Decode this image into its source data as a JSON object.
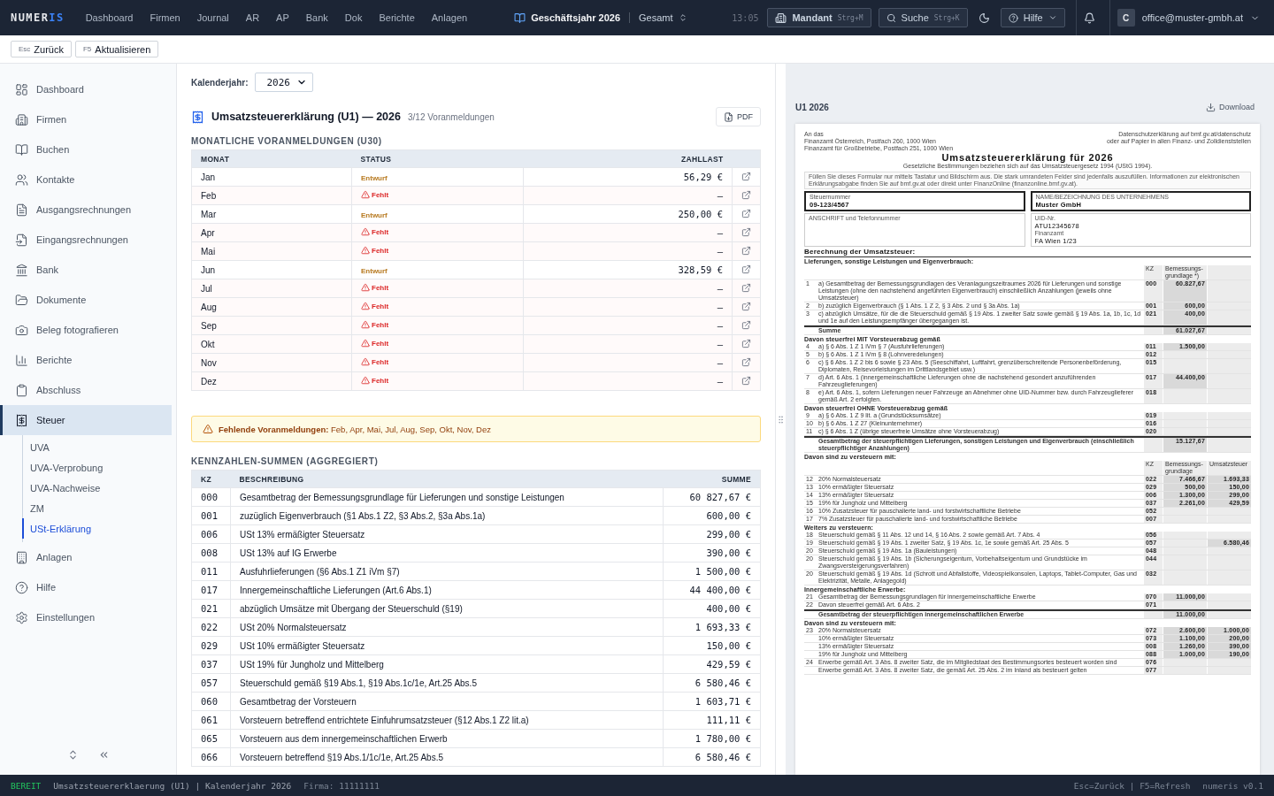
{
  "topbar": {
    "logo_main": "NUMER",
    "logo_accent": "IS",
    "nav": [
      "Dashboard",
      "Firmen",
      "Journal",
      "AR",
      "AP",
      "Bank",
      "Dok",
      "Berichte",
      "Anlagen"
    ],
    "fiscal_year": "Geschäftsjahr 2026",
    "scope": "Gesamt",
    "time": "13:05",
    "mandant": {
      "label": "Mandant",
      "shortcut": "Strg+M"
    },
    "search": {
      "label": "Suche",
      "shortcut": "Strg+K"
    },
    "help": "Hilfe",
    "avatar": "C",
    "email": "office@muster-gmbh.at"
  },
  "toolbar": [
    {
      "key": "Esc",
      "label": "Zurück"
    },
    {
      "key": "F5",
      "label": "Aktualisieren"
    }
  ],
  "sidebar": {
    "items": [
      {
        "label": "Dashboard",
        "selected": false
      },
      {
        "label": "Firmen",
        "selected": false
      },
      {
        "label": "Buchen",
        "selected": false
      },
      {
        "label": "Kontakte",
        "selected": false
      },
      {
        "label": "Ausgangsrechnungen",
        "selected": false
      },
      {
        "label": "Eingangsrechnungen",
        "selected": false
      },
      {
        "label": "Bank",
        "selected": false
      },
      {
        "label": "Dokumente",
        "selected": false
      },
      {
        "label": "Beleg fotografieren",
        "selected": false
      },
      {
        "label": "Berichte",
        "selected": false
      },
      {
        "label": "Abschluss",
        "selected": false
      },
      {
        "label": "Steuer",
        "selected": true,
        "children": [
          {
            "label": "UVA",
            "selected": false
          },
          {
            "label": "UVA-Verprobung",
            "selected": false
          },
          {
            "label": "UVA-Nachweise",
            "selected": false
          },
          {
            "label": "ZM",
            "selected": false
          },
          {
            "label": "USt-Erklärung",
            "selected": true
          }
        ]
      },
      {
        "label": "Anlagen",
        "selected": false
      },
      {
        "label": "Hilfe",
        "selected": false
      },
      {
        "label": "Einstellungen",
        "selected": false
      }
    ]
  },
  "filter": {
    "label": "Kalenderjahr:",
    "value": "2026"
  },
  "card": {
    "title": "Umsatzsteuererklärung (U1) — 2026",
    "subtitle": "3/12 Voranmeldungen",
    "pdf_button": "PDF"
  },
  "monthly": {
    "heading": "MONATLICHE VORANMELDUNGEN (U30)",
    "columns": [
      "MONAT",
      "STATUS",
      "ZAHLLAST"
    ],
    "rows": [
      {
        "month": "Jan",
        "status": {
          "kind": "draft",
          "label": "Entwurf"
        },
        "amount": "56,29 €"
      },
      {
        "month": "Feb",
        "status": {
          "kind": "missing",
          "label": "Fehlt"
        },
        "amount": "–"
      },
      {
        "month": "Mar",
        "status": {
          "kind": "draft",
          "label": "Entwurf"
        },
        "amount": "250,00 €"
      },
      {
        "month": "Apr",
        "status": {
          "kind": "missing",
          "label": "Fehlt"
        },
        "amount": "–"
      },
      {
        "month": "Mai",
        "status": {
          "kind": "missing",
          "label": "Fehlt"
        },
        "amount": "–"
      },
      {
        "month": "Jun",
        "status": {
          "kind": "draft",
          "label": "Entwurf"
        },
        "amount": "328,59 €"
      },
      {
        "month": "Jul",
        "status": {
          "kind": "missing",
          "label": "Fehlt"
        },
        "amount": "–"
      },
      {
        "month": "Aug",
        "status": {
          "kind": "missing",
          "label": "Fehlt"
        },
        "amount": "–"
      },
      {
        "month": "Sep",
        "status": {
          "kind": "missing",
          "label": "Fehlt"
        },
        "amount": "–"
      },
      {
        "month": "Okt",
        "status": {
          "kind": "missing",
          "label": "Fehlt"
        },
        "amount": "–"
      },
      {
        "month": "Nov",
        "status": {
          "kind": "missing",
          "label": "Fehlt"
        },
        "amount": "–"
      },
      {
        "month": "Dez",
        "status": {
          "kind": "missing",
          "label": "Fehlt"
        },
        "amount": "–"
      }
    ]
  },
  "warning": "**Fehlende Voranmeldungen:** Feb, Apr, Mai, Jul, Aug, Sep, Okt, Nov, Dez",
  "totals": {
    "heading": "KENNZAHLEN-SUMMEN (AGGREGIERT)",
    "columns": [
      "KZ",
      "BESCHREIBUNG",
      "SUMME"
    ],
    "rows": [
      {
        "kz": "000",
        "text": "Gesamtbetrag der Bemessungsgrundlage für Lieferungen und sonstige Leistungen",
        "sum": "60 827,67 €"
      },
      {
        "kz": "001",
        "text": "zuzüglich Eigenverbrauch (§1 Abs.1 Z2, §3 Abs.2, §3a Abs.1a)",
        "sum": "600,00 €"
      },
      {
        "kz": "006",
        "text": "USt 13% ermäßigter Steuersatz",
        "sum": "299,00 €"
      },
      {
        "kz": "008",
        "text": "USt 13% auf IG Erwerbe",
        "sum": "390,00 €"
      },
      {
        "kz": "011",
        "text": "Ausfuhrlieferungen (§6 Abs.1 Z1 iVm §7)",
        "sum": "1 500,00 €"
      },
      {
        "kz": "017",
        "text": "Innergemeinschaftliche Lieferungen (Art.6 Abs.1)",
        "sum": "44 400,00 €"
      },
      {
        "kz": "021",
        "text": "abzüglich Umsätze mit Übergang der Steuerschuld (§19)",
        "sum": "400,00 €"
      },
      {
        "kz": "022",
        "text": "USt 20% Normalsteuersatz",
        "sum": "1 693,33 €"
      },
      {
        "kz": "029",
        "text": "USt 10% ermäßigter Steuersatz",
        "sum": "150,00 €"
      },
      {
        "kz": "037",
        "text": "USt 19% für Jungholz und Mittelberg",
        "sum": "429,59 €"
      },
      {
        "kz": "057",
        "text": "Steuerschuld gemäß §19 Abs.1, §19 Abs.1c/1e, Art.25 Abs.5",
        "sum": "6 580,46 €"
      },
      {
        "kz": "060",
        "text": "Gesamtbetrag der Vorsteuern",
        "sum": "1 603,71 €"
      },
      {
        "kz": "061",
        "text": "Vorsteuern betreffend entrichtete Einfuhrumsatzsteuer (§12 Abs.1 Z2 lit.a)",
        "sum": "111,11 €"
      },
      {
        "kz": "065",
        "text": "Vorsteuern aus dem innergemeinschaftlichen Erwerb",
        "sum": "1 780,00 €"
      },
      {
        "kz": "066",
        "text": "Vorsteuern betreffend §19 Abs.1/1c/1e, Art.25 Abs.5",
        "sum": "6 580,46 €"
      }
    ]
  },
  "preview": {
    "title": "U1 2026",
    "download": "Download",
    "document": {
      "address": [
        "An das",
        "Finanzamt Österreich, Postfach 260, 1000 Wien",
        "Finanzamt für Großbetriebe, Postfach 251, 1000 Wien"
      ],
      "privacy": [
        "Datenschutzerklärung auf bmf.gv.at/datenschutz",
        "oder auf Papier in allen Finanz- und Zolldienststellen"
      ],
      "title": "Umsatzsteuererklärung für 2026",
      "subtitle": "Gesetzliche Bestimmungen beziehen sich auf das Umsatzsteuergesetz 1994 (UStG 1994).",
      "notice": "Füllen Sie dieses Formular nur mittels Tastatur und Bildschirm aus. Die stark umrandeten Felder sind jedenfalls auszufüllen. Informationen zur elektronischen Erklärungsabgabe finden Sie auf bmf.gv.at oder direkt unter FinanzOnline (finanzonline.bmf.gv.at).",
      "tax_number": {
        "label": "Steuernummer",
        "value": "09-123/4567"
      },
      "company": {
        "label": "NAME/BEZEICHNUNG DES UNTERNEHMENS",
        "value": "Muster GmbH"
      },
      "address_field": {
        "label": "ANSCHRIFT und Telefonnummer"
      },
      "uid": {
        "label": "UID-Nr.",
        "value": "ATU12345678"
      },
      "office": {
        "label": "Finanzamt",
        "value": "FA Wien 1/23"
      },
      "section": "Berechnung der Umsatzsteuer:",
      "blocks": [
        {
          "heading": "Lieferungen, sonstige Leistungen und Eigenverbrauch:",
          "columns": [
            "KZ",
            "Bemessungs- grundlage *)"
          ],
          "rows": [
            {
              "kind": "line",
              "nr": "1",
              "text": "a) Gesamtbetrag der Bemessungsgrundlagen des Veranlagungszeitraumes 2026 für Lieferungen und sonstige Leistungen (ohne den nachstehend angeführten Eigenverbrauch) einschließlich Anzahlungen (jeweils ohne Umsatzsteuer)",
              "kz": "000",
              "base": "60.827,67"
            },
            {
              "kind": "line",
              "nr": "2",
              "text": "b) zuzüglich Eigenverbrauch (§ 1 Abs. 1 Z 2, § 3 Abs. 2 und § 3a Abs. 1a)",
              "kz": "001",
              "base": "600,00"
            },
            {
              "kind": "line",
              "nr": "3",
              "text": "c) abzüglich Umsätze, für die die Steuerschuld gemäß § 19 Abs. 1 zweiter Satz sowie gemäß § 19 Abs. 1a, 1b, 1c, 1d und 1e auf den Leistungsempfänger übergegangen ist.",
              "kz": "021",
              "base": "400,00"
            },
            {
              "kind": "sum",
              "text": "Summe",
              "base": "61.027,67"
            }
          ]
        },
        {
          "heading": "Davon steuerfrei MIT Vorsteuerabzug gemäß",
          "rows": [
            {
              "kind": "line",
              "nr": "4",
              "text": "a) § 6 Abs. 1 Z 1 iVm § 7 (Ausfuhrlieferungen)",
              "kz": "011",
              "base": "1.500,00"
            },
            {
              "kind": "line",
              "nr": "5",
              "text": "b) § 6 Abs. 1 Z 1 iVm § 8 (Lohnveredelungen)",
              "kz": "012"
            },
            {
              "kind": "line",
              "nr": "6",
              "text": "c) § 6 Abs. 1 Z 2 bis 6 sowie § 23 Abs. 5 (Seeschiffahrt, Luftfahrt, grenzüberschreitende Personenbeförderung, Diplomaten, Reisevorleistungen im Drittlandsgebiet usw.)",
              "kz": "015"
            },
            {
              "kind": "line",
              "nr": "7",
              "text": "d) Art. 6 Abs. 1 (innergemeinschaftliche Lieferungen ohne die nachstehend gesondert anzuführenden Fahrzeuglieferungen)",
              "kz": "017",
              "base": "44.400,00"
            },
            {
              "kind": "line",
              "nr": "8",
              "text": "e) Art. 6 Abs. 1, sofern Lieferungen neuer Fahrzeuge an Abnehmer ohne UID-Nummer bzw. durch Fahrzeuglieferer gemäß Art. 2 erfolgten.",
              "kz": "018"
            }
          ]
        },
        {
          "heading": "Davon steuerfrei OHNE Vorsteuerabzug gemäß",
          "rows": [
            {
              "kind": "line",
              "nr": "9",
              "text": "a) § 6 Abs. 1 Z 9 lit. a (Grundstücksumsätze)",
              "kz": "019"
            },
            {
              "kind": "line",
              "nr": "10",
              "text": "b) § 6 Abs. 1 Z 27 (Kleinunternehmer)",
              "kz": "016"
            },
            {
              "kind": "line",
              "nr": "11",
              "text": "c) § 6 Abs. 1 Z (übrige steuerfreie Umsätze ohne Vorsteuerabzug)",
              "kz": "020"
            },
            {
              "kind": "sum",
              "text": "Gesamtbetrag der steuerpflichtigen Lieferungen, sonstigen Leistungen und Eigenverbrauch (einschließlich steuerpflichtiger Anzahlungen)",
              "base": "15.127,67"
            }
          ]
        },
        {
          "heading": "Davon sind zu versteuern mit:",
          "columns": [
            "KZ",
            "Bemessungs- grundlage",
            "Umsatzsteuer"
          ],
          "rows": [
            {
              "kind": "line",
              "nr": "12",
              "text": "20% Normalsteuersatz",
              "kz": "022",
              "base": "7.466,67",
              "tax": "1.693,33"
            },
            {
              "kind": "line",
              "nr": "13",
              "text": "10% ermäßigter Steuersatz",
              "kz": "029",
              "base": "500,00",
              "tax": "150,00"
            },
            {
              "kind": "line",
              "nr": "14",
              "text": "13% ermäßigter Steuersatz",
              "kz": "006",
              "base": "1.300,00",
              "tax": "299,00"
            },
            {
              "kind": "line",
              "nr": "15",
              "text": "19% für Jungholz und Mittelberg",
              "kz": "037",
              "base": "2.261,00",
              "tax": "429,59"
            },
            {
              "kind": "line",
              "nr": "16",
              "text": "10% Zusatzsteuer für pauschalierte land- und forstwirtschaftliche Betriebe",
              "kz": "052"
            },
            {
              "kind": "line",
              "nr": "17",
              "text": "7% Zusatzsteuer für pauschalierte land- und forstwirtschaftliche Betriebe",
              "kz": "007"
            }
          ]
        },
        {
          "heading": "Weiters zu versteuern:",
          "rows": [
            {
              "kind": "line",
              "nr": "18",
              "text": "Steuerschuld gemäß § 11 Abs. 12 und 14, § 16 Abs. 2 sowie gemäß Art. 7 Abs. 4",
              "kz": "056"
            },
            {
              "kind": "line",
              "nr": "19",
              "text": "Steuerschuld gemäß § 19 Abs. 1 zweiter Satz, § 19 Abs. 1c, 1e sowie gemäß Art. 25 Abs. 5",
              "kz": "057",
              "tax": "6.580,46"
            },
            {
              "kind": "line",
              "nr": "20",
              "text": "Steuerschuld gemäß § 19 Abs. 1a (Bauleistungen)",
              "kz": "048"
            },
            {
              "kind": "line",
              "nr": "20",
              "text": "Steuerschuld gemäß § 19 Abs. 1b (Sicherungseigentum, Vorbehaltseigentum und Grundstücke im Zwangsversteigerungsverfahren)",
              "kz": "044"
            },
            {
              "kind": "line",
              "nr": "20",
              "text": "Steuerschuld gemäß § 19 Abs. 1d (Schrott und Abfallstoffe, Videospielkonsolen, Laptops, Tablet-Computer, Gas und Elektrizität, Metalle, Anlagegold)",
              "kz": "032"
            }
          ]
        },
        {
          "heading": "Innergemeinschaftliche Erwerbe:",
          "rows": [
            {
              "kind": "line",
              "nr": "21",
              "text": "Gesamtbetrag der Bemessungsgrundlagen für innergemeinschaftliche Erwerbe",
              "kz": "070",
              "base": "11.000,00"
            },
            {
              "kind": "line",
              "nr": "22",
              "text": "Davon steuerfrei gemäß Art. 6 Abs. 2",
              "kz": "071"
            },
            {
              "kind": "sum",
              "text": "Gesamtbetrag der steuerpflichtigen innergemeinschaftlichen Erwerbe",
              "base": "11.000,00"
            }
          ]
        },
        {
          "heading": "Davon sind zu versteuern mit:",
          "rows": [
            {
              "kind": "line",
              "nr": "23",
              "text": "20% Normalsteuersatz",
              "kz": "072",
              "base": "2.600,00",
              "tax": "1.000,00"
            },
            {
              "kind": "line",
              "text": "10% ermäßigter Steuersatz",
              "kz": "073",
              "base": "1.100,00",
              "tax": "200,00"
            },
            {
              "kind": "line",
              "text": "13% ermäßigter Steuersatz",
              "kz": "008",
              "base": "1.260,00",
              "tax": "390,00"
            },
            {
              "kind": "line",
              "text": "19% für Jungholz und Mittelberg",
              "kz": "088",
              "base": "1.000,00",
              "tax": "190,00"
            },
            {
              "kind": "line",
              "nr": "24",
              "text": "Erwerbe gemäß Art. 3 Abs. 8 zweiter Satz, die im Mitgliedstaat des Bestimmungsortes besteuert worden sind",
              "kz": "076"
            },
            {
              "kind": "line",
              "text": "Erwerbe gemäß Art. 3 Abs. 8 zweiter Satz, die gemäß Art. 25 Abs. 2 im Inland als besteuert gelten",
              "kz": "077"
            }
          ]
        }
      ]
    }
  },
  "status_bar": {
    "state": "BEREIT",
    "context": "Umsatzsteuererklaerung (U1) | Kalenderjahr 2026",
    "firm": "Firma: 11111111",
    "hints": "Esc=Zurück | F5=Refresh",
    "version": "numeris v0.1"
  }
}
